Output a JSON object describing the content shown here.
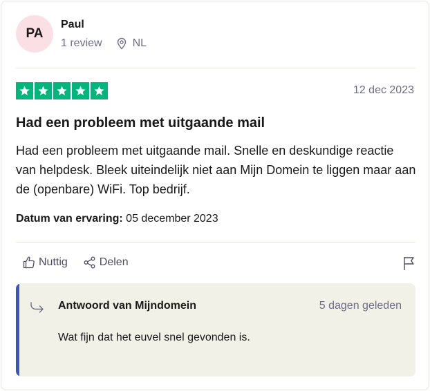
{
  "reviewer": {
    "initials": "PA",
    "name": "Paul",
    "review_count": "1 review",
    "country": "NL"
  },
  "review": {
    "rating": 5,
    "rating_color": "#00b67a",
    "date": "12 dec 2023",
    "title": "Had een probleem met uitgaande mail",
    "body": "Had een probleem met uitgaande mail. Snelle en deskundige reactie van helpdesk. Bleek uiteindelijk niet aan Mijn Domein te liggen maar aan de (openbare) WiFi. Top bedrijf.",
    "experience_label": "Datum van ervaring:",
    "experience_date": "05 december 2023"
  },
  "actions": {
    "useful_label": "Nuttig",
    "share_label": "Delen",
    "useful_icon": "thumbs-up-icon",
    "share_icon": "share-icon",
    "flag_icon": "flag-icon"
  },
  "reply": {
    "title": "Antwoord van Mijndomein",
    "date": "5 dagen geleden",
    "text": "Wat fijn dat het euvel snel gevonden is.",
    "accent_color": "#3c57bc",
    "icon": "reply-arrow-icon"
  }
}
